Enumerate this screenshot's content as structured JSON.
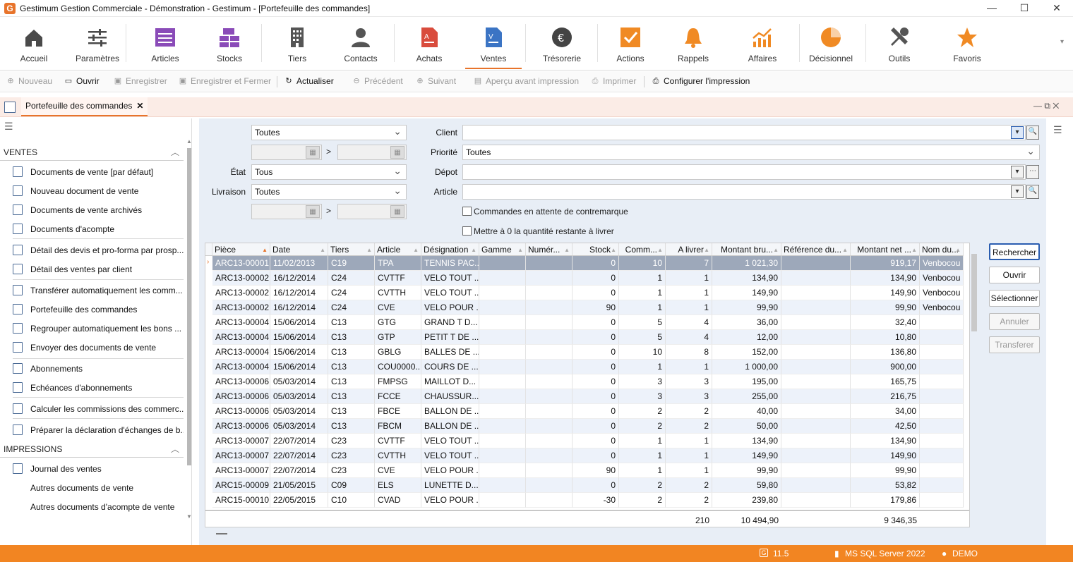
{
  "window": {
    "title": "Gestimum Gestion Commerciale - Démonstration - Gestimum - [Portefeuille des commandes]",
    "logo": "G"
  },
  "ribbon": [
    {
      "label": "Accueil",
      "icon": "home-icon",
      "color": "#4a4a4a"
    },
    {
      "label": "Paramètres",
      "icon": "sliders-icon",
      "color": "#4a4a4a"
    },
    {
      "label": "Articles",
      "icon": "articles-icon",
      "color": "#8a4bb8"
    },
    {
      "label": "Stocks",
      "icon": "stocks-icon",
      "color": "#8a4bb8"
    },
    {
      "label": "Tiers",
      "icon": "building-icon",
      "color": "#555"
    },
    {
      "label": "Contacts",
      "icon": "person-icon",
      "color": "#555"
    },
    {
      "label": "Achats",
      "icon": "purchase-doc-icon",
      "color": "#d94c3d"
    },
    {
      "label": "Ventes",
      "icon": "sales-doc-icon",
      "color": "#3b74c4"
    },
    {
      "label": "Trésorerie",
      "icon": "euro-icon",
      "color": "#444"
    },
    {
      "label": "Actions",
      "icon": "check-box-icon",
      "color": "#f08a24"
    },
    {
      "label": "Rappels",
      "icon": "bell-icon",
      "color": "#f08a24"
    },
    {
      "label": "Affaires",
      "icon": "growth-chart-icon",
      "color": "#f08a24"
    },
    {
      "label": "Décisionnel",
      "icon": "pie-chart-icon",
      "color": "#f08a24"
    },
    {
      "label": "Outils",
      "icon": "tools-icon",
      "color": "#555"
    },
    {
      "label": "Favoris",
      "icon": "star-icon",
      "color": "#f08a24"
    }
  ],
  "toolbar": [
    {
      "label": "Nouveau",
      "icon": "plus-icon",
      "enabled": false
    },
    {
      "label": "Ouvrir",
      "icon": "folder-icon",
      "enabled": true
    },
    {
      "label": "Enregistrer",
      "icon": "save-icon",
      "enabled": false
    },
    {
      "label": "Enregistrer et Fermer",
      "icon": "save-close-icon",
      "enabled": false
    },
    {
      "label": "Actualiser",
      "icon": "refresh-icon",
      "enabled": true
    },
    {
      "label": "Précédent",
      "icon": "arrow-left-icon",
      "enabled": false
    },
    {
      "label": "Suivant",
      "icon": "arrow-right-icon",
      "enabled": false
    },
    {
      "label": "Aperçu avant impression",
      "icon": "preview-icon",
      "enabled": false
    },
    {
      "label": "Imprimer",
      "icon": "printer-icon",
      "enabled": false
    },
    {
      "label": "Configurer l'impression",
      "icon": "print-setup-icon",
      "enabled": true
    }
  ],
  "tab": {
    "label": "Portefeuille des commandes",
    "close": "✕"
  },
  "sidebar": {
    "sections": [
      {
        "title": "VENTES",
        "items": [
          "Documents de vente [par défaut]",
          "Nouveau document de vente",
          "Documents de vente archivés",
          "Documents d'acompte",
          "Détail des devis et pro-forma par prosp...",
          "Détail des ventes par client",
          "Transférer automatiquement les comm...",
          "Portefeuille des commandes",
          "Regrouper automatiquement les bons ...",
          "Envoyer des documents de vente",
          "Abonnements",
          "Echéances d'abonnements",
          "Calculer les commissions des commerc...",
          "Préparer la déclaration d'échanges de b..."
        ]
      },
      {
        "title": "IMPRESSIONS",
        "items": [
          "Journal des ventes",
          "Autres documents de vente",
          "Autres documents d'acompte de vente"
        ]
      }
    ]
  },
  "filters": {
    "period": "Toutes",
    "gt": ">",
    "etat_label": "État",
    "etat": "Tous",
    "livraison_label": "Livraison",
    "livraison": "Toutes",
    "client_label": "Client",
    "client": "",
    "priorite_label": "Priorité",
    "priorite": "Toutes",
    "depot_label": "Dépot",
    "depot": "",
    "article_label": "Article",
    "article": "",
    "chk1": "Commandes en attente de contremarque",
    "chk2": "Mettre à 0 la quantité restante à livrer"
  },
  "grid": {
    "columns": [
      "Pièce",
      "Date",
      "Tiers",
      "Article",
      "Désignation",
      "Gamme",
      "Numér...",
      "Stock",
      "Comm...",
      "A livrer",
      "Montant bru...",
      "Référence du...",
      "Montant net ...",
      "Nom du..."
    ],
    "rows": [
      [
        "ARC13-00001",
        "11/02/2013",
        "C19",
        "TPA",
        "TENNIS PAC...",
        "",
        "",
        "0",
        "10",
        "7",
        "1 021,30",
        "",
        "919,17",
        "Venbocou"
      ],
      [
        "ARC13-00002",
        "16/12/2014",
        "C24",
        "CVTTF",
        "VELO TOUT ...",
        "",
        "",
        "0",
        "1",
        "1",
        "134,90",
        "",
        "134,90",
        "Venbocou"
      ],
      [
        "ARC13-00002",
        "16/12/2014",
        "C24",
        "CVTTH",
        "VELO TOUT ...",
        "",
        "",
        "0",
        "1",
        "1",
        "149,90",
        "",
        "149,90",
        "Venbocou"
      ],
      [
        "ARC13-00002",
        "16/12/2014",
        "C24",
        "CVE",
        "VELO POUR ...",
        "",
        "",
        "90",
        "1",
        "1",
        "99,90",
        "",
        "99,90",
        "Venbocou"
      ],
      [
        "ARC13-00004",
        "15/06/2014",
        "C13",
        "GTG",
        "GRAND T D...",
        "",
        "",
        "0",
        "5",
        "4",
        "36,00",
        "",
        "32,40",
        ""
      ],
      [
        "ARC13-00004",
        "15/06/2014",
        "C13",
        "GTP",
        "PETIT T DE ...",
        "",
        "",
        "0",
        "5",
        "4",
        "12,00",
        "",
        "10,80",
        ""
      ],
      [
        "ARC13-00004",
        "15/06/2014",
        "C13",
        "GBLG",
        "BALLES DE ...",
        "",
        "",
        "0",
        "10",
        "8",
        "152,00",
        "",
        "136,80",
        ""
      ],
      [
        "ARC13-00004",
        "15/06/2014",
        "C13",
        "COU0000...",
        "COURS DE ...",
        "",
        "",
        "0",
        "1",
        "1",
        "1 000,00",
        "",
        "900,00",
        ""
      ],
      [
        "ARC13-00006",
        "05/03/2014",
        "C13",
        "FMPSG",
        "MAILLOT D...",
        "",
        "",
        "0",
        "3",
        "3",
        "195,00",
        "",
        "165,75",
        ""
      ],
      [
        "ARC13-00006",
        "05/03/2014",
        "C13",
        "FCCE",
        "CHAUSSUR...",
        "",
        "",
        "0",
        "3",
        "3",
        "255,00",
        "",
        "216,75",
        ""
      ],
      [
        "ARC13-00006",
        "05/03/2014",
        "C13",
        "FBCE",
        "BALLON DE ...",
        "",
        "",
        "0",
        "2",
        "2",
        "40,00",
        "",
        "34,00",
        ""
      ],
      [
        "ARC13-00006",
        "05/03/2014",
        "C13",
        "FBCM",
        "BALLON DE ...",
        "",
        "",
        "0",
        "2",
        "2",
        "50,00",
        "",
        "42,50",
        ""
      ],
      [
        "ARC13-00007",
        "22/07/2014",
        "C23",
        "CVTTF",
        "VELO TOUT ...",
        "",
        "",
        "0",
        "1",
        "1",
        "134,90",
        "",
        "134,90",
        ""
      ],
      [
        "ARC13-00007",
        "22/07/2014",
        "C23",
        "CVTTH",
        "VELO TOUT ...",
        "",
        "",
        "0",
        "1",
        "1",
        "149,90",
        "",
        "149,90",
        ""
      ],
      [
        "ARC13-00007",
        "22/07/2014",
        "C23",
        "CVE",
        "VELO POUR ...",
        "",
        "",
        "90",
        "1",
        "1",
        "99,90",
        "",
        "99,90",
        ""
      ],
      [
        "ARC15-00009",
        "21/05/2015",
        "C09",
        "ELS",
        "LUNETTE D...",
        "",
        "",
        "0",
        "2",
        "2",
        "59,80",
        "",
        "53,82",
        ""
      ],
      [
        "ARC15-00010",
        "22/05/2015",
        "C10",
        "CVAD",
        "VELO POUR ...",
        "",
        "",
        "-30",
        "2",
        "2",
        "239,80",
        "",
        "179,86",
        ""
      ]
    ],
    "totals": {
      "a_livrer": "210",
      "montant_brut": "10 494,90",
      "montant_net": "9 346,35"
    }
  },
  "actions": [
    {
      "label": "Rechercher",
      "enabled": true
    },
    {
      "label": "Ouvrir",
      "enabled": true
    },
    {
      "label": "Sélectionner",
      "enabled": true
    },
    {
      "label": "Annuler",
      "enabled": false
    },
    {
      "label": "Transferer",
      "enabled": false
    }
  ],
  "status": {
    "version": "11.5",
    "server": "MS SQL Server 2022",
    "user": "DEMO"
  }
}
